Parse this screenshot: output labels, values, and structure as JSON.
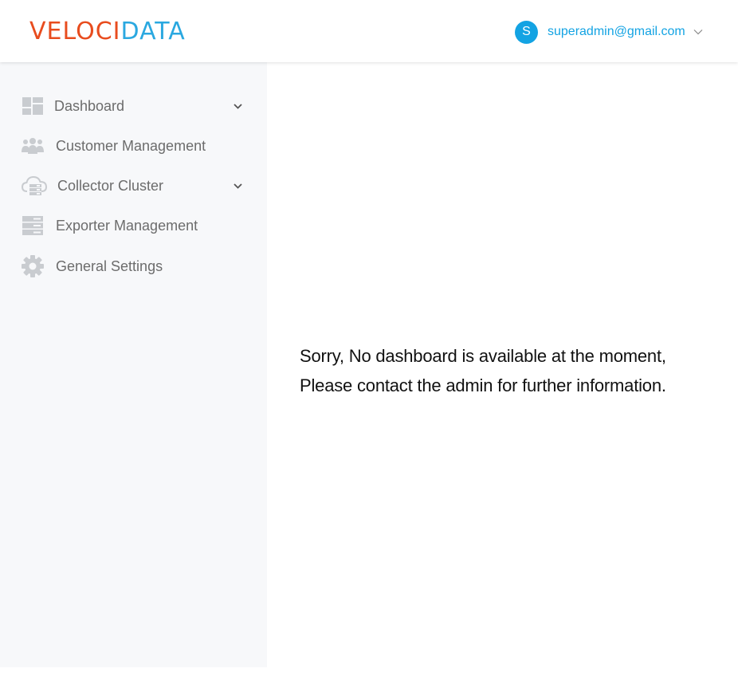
{
  "header": {
    "logo": {
      "part1": "VELOCI",
      "part2": "DATA"
    },
    "user": {
      "avatar_letter": "S",
      "email": "superadmin@gmail.com"
    }
  },
  "sidebar": {
    "items": [
      {
        "label": "Dashboard",
        "icon": "dashboard-icon",
        "has_chevron": true
      },
      {
        "label": "Customer Management",
        "icon": "users-icon",
        "has_chevron": false
      },
      {
        "label": "Collector Cluster",
        "icon": "cloud-server-icon",
        "has_chevron": true
      },
      {
        "label": "Exporter Management",
        "icon": "server-rack-icon",
        "has_chevron": false
      },
      {
        "label": "General Settings",
        "icon": "gear-icon",
        "has_chevron": false
      }
    ]
  },
  "main": {
    "empty_message": "Sorry, No dashboard is available at the moment, Please contact the admin for further information."
  },
  "colors": {
    "logo_primary": "#e84c1e",
    "logo_secondary": "#2aa8e0",
    "accent": "#13a3e3",
    "sidebar_bg": "#f7f8fa",
    "sidebar_text": "#6c6c6c",
    "icon_gray": "#c9ccd0"
  }
}
